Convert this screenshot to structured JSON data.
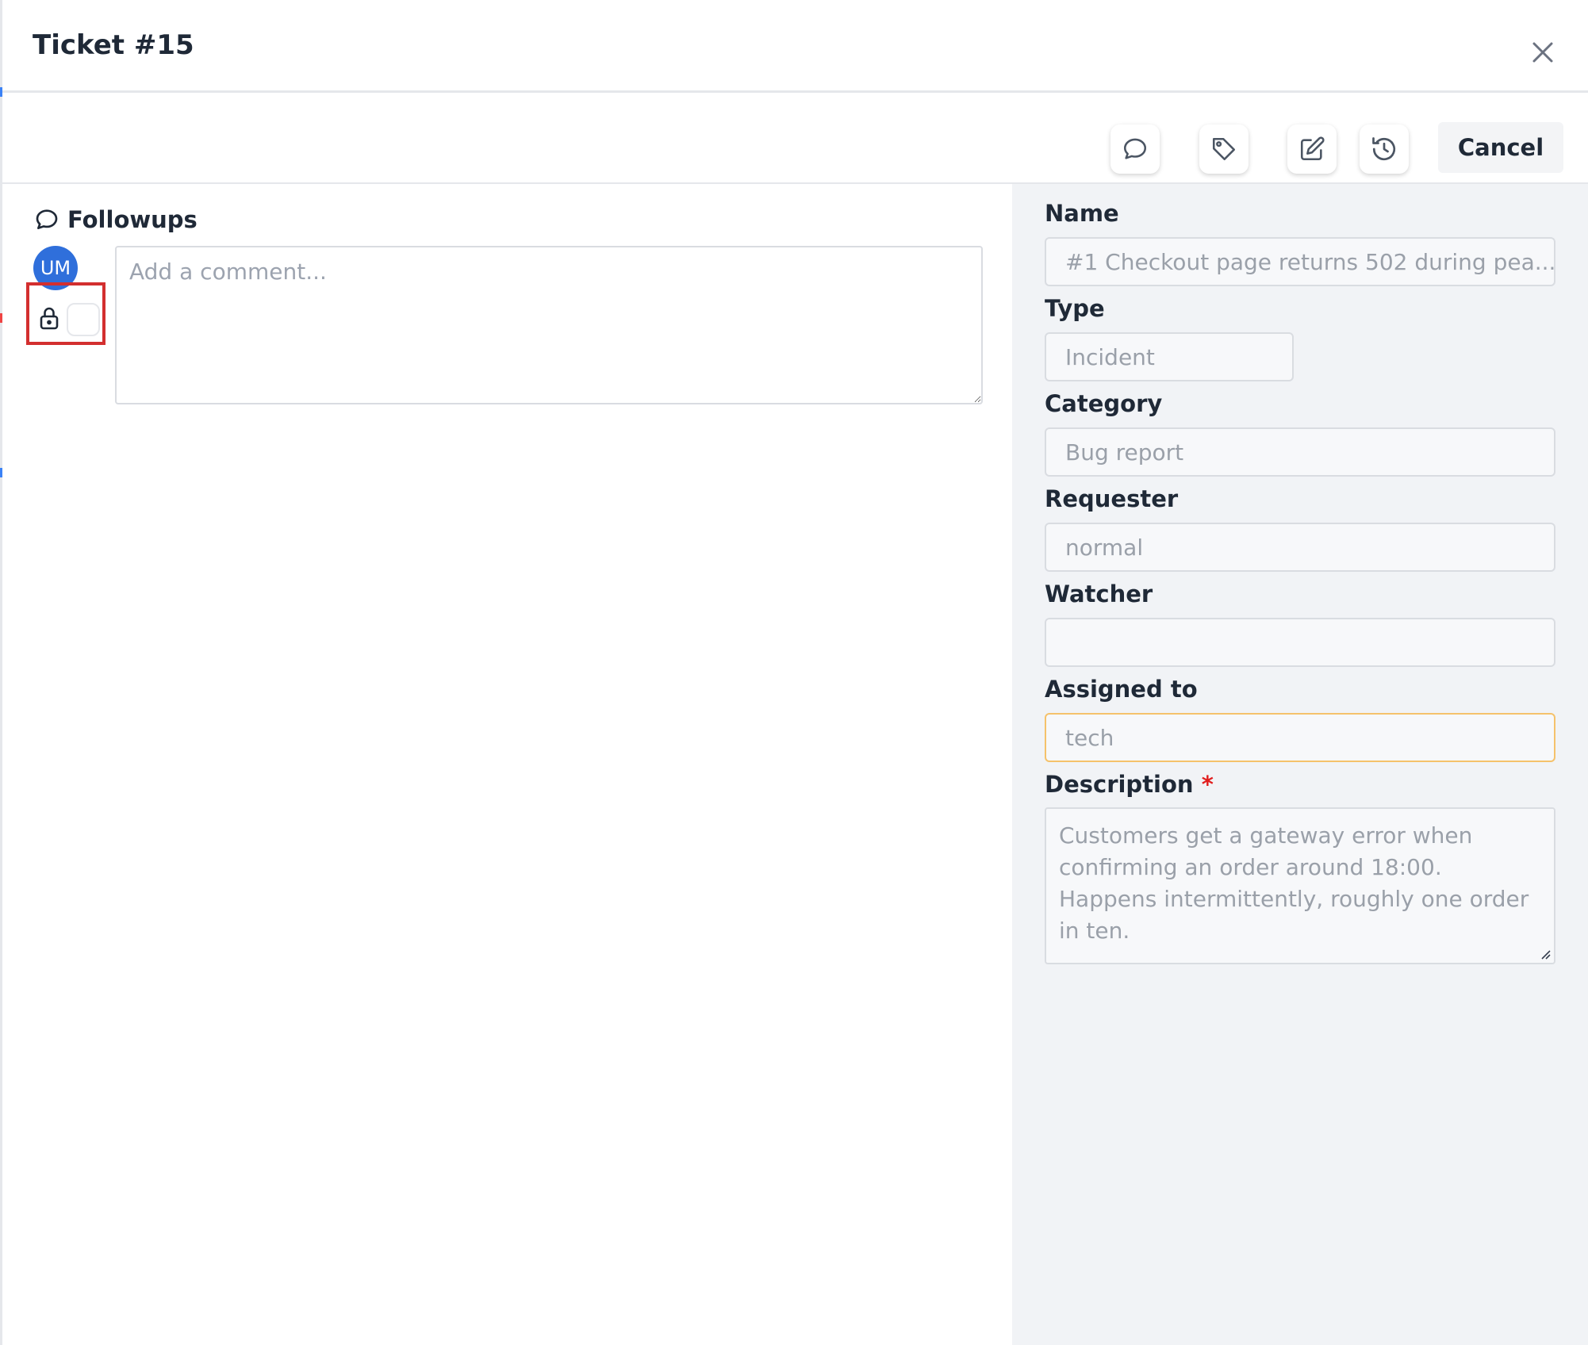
{
  "modal": {
    "title": "Ticket #15"
  },
  "toolbar": {
    "buttons": [
      {
        "icon": "chat-bubble-icon"
      },
      {
        "icon": "tag-icon"
      },
      {
        "icon": "edit-icon"
      },
      {
        "icon": "history-icon"
      }
    ],
    "cancel_label": "Cancel"
  },
  "followups": {
    "title": "Followups",
    "avatar_initials": "UM",
    "comment_placeholder": "Add a comment...",
    "comment_value": "",
    "private_toggle_checked": false
  },
  "form": {
    "name": {
      "label": "Name",
      "value": "#1 Checkout page returns 502 during pea..."
    },
    "type": {
      "label": "Type",
      "value": "Incident"
    },
    "category": {
      "label": "Category",
      "value": "Bug report"
    },
    "requester": {
      "label": "Requester",
      "value": "normal"
    },
    "watcher": {
      "label": "Watcher",
      "value": ""
    },
    "assigned_to": {
      "label": "Assigned to",
      "value": "tech"
    },
    "description": {
      "label": "Description",
      "required_mark": "*",
      "value": "Customers get a gateway error when confirming an order around 18:00. Happens intermittently, roughly one order in ten."
    }
  },
  "colors": {
    "avatar": "#2f6fdb",
    "highlight_box": "#d32f2f",
    "required": "#e11d1d",
    "assigned_border": "#f5c26b",
    "sidebar_bg": "#f1f3f6"
  }
}
